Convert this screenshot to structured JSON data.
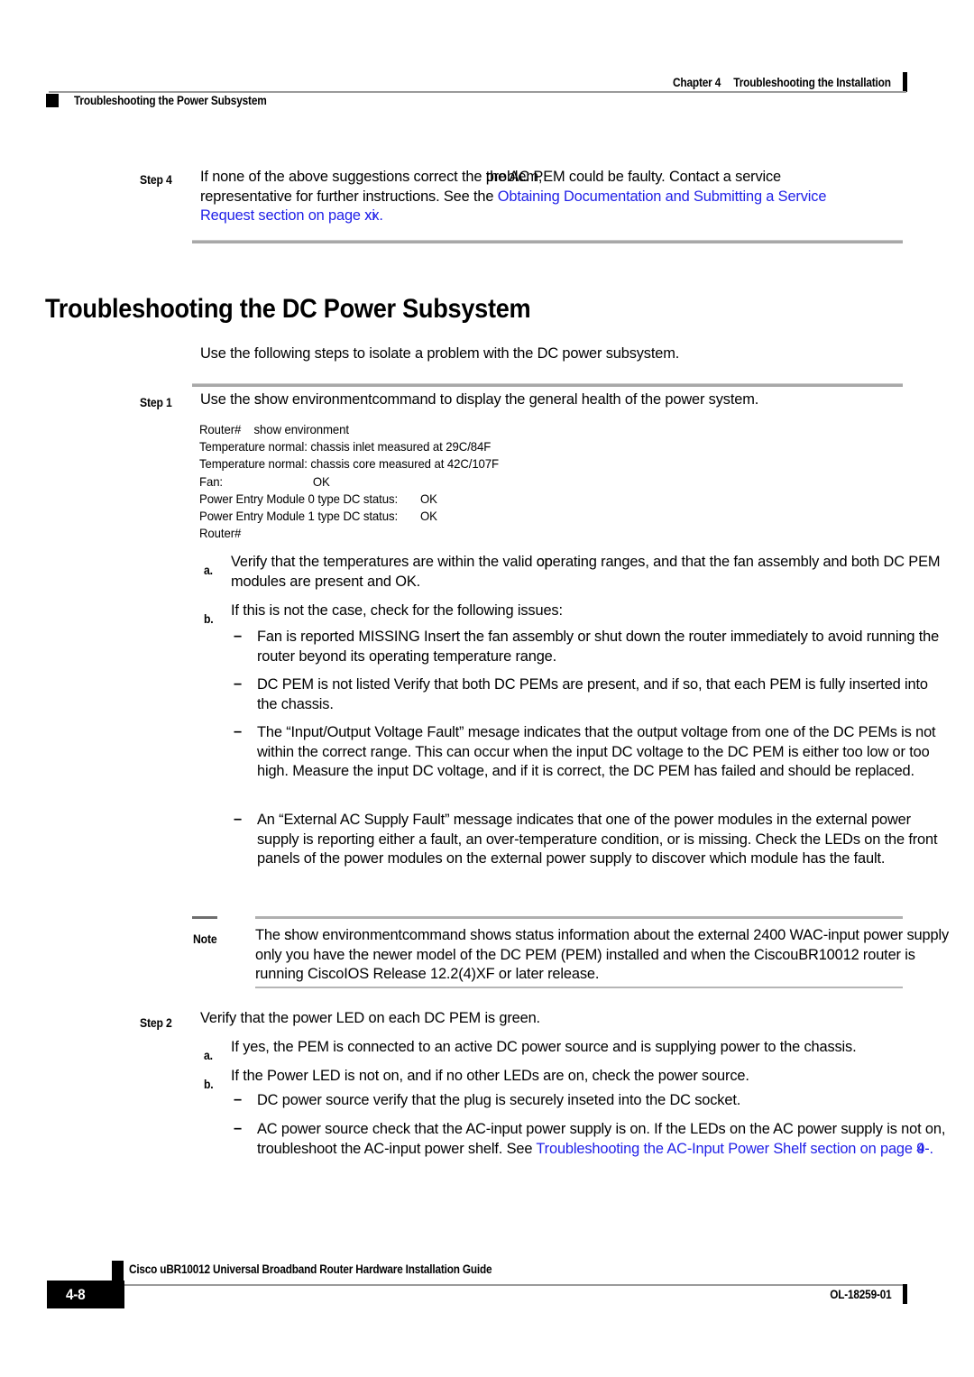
{
  "header": {
    "chapter_num": "Chapter 4",
    "chapter_title": "Troubleshooting the Installation",
    "section_title": "Troubleshooting the Power Subsystem"
  },
  "step4": {
    "label": "Step 4",
    "line1_a": "If none of the above suggestions correct the problem,",
    "line1_b": "the AC PEM could be faulty. Contact a service",
    "line1_prefix": "If none of the above suggestions correct the ",
    "line2_plain": "representative for further instructions. See the ",
    "line2_link": "Obtaining Documentation and Submitting a Service",
    "line3_link": "Request",
    "line3_mid": " section on page ",
    "line3_page_a": "xx",
    "line3_page_b": "xi",
    "line3_end": "."
  },
  "heading": "Troubleshooting the DC Power Subsystem",
  "intro": "Use the following steps to isolate a problem with the DC power subsystem.",
  "step1": {
    "label": "Step 1",
    "text_prefix": "Use the ",
    "command_a": "show environment",
    "command_b": "command",
    "text_suffix": " to display the general health of the power system."
  },
  "cli_output": "Router#    show environment\nTemperature normal: chassis inlet measured at 29C/84F\nTemperature normal: chassis core measured at 42C/107F\nFan:                            OK\nPower Entry Module 0 type DC status:       OK\nPower Entry Module 1 type DC status:       OK\nRouter#",
  "step1_items": [
    {
      "label": "a.",
      "pre": "Verify that the temperatures are within the valid ",
      "ovl_a": "oper",
      "ovl_b": "op",
      "post": "ating ranges, and that the fan assembly and both DC PEM modules are present and OK."
    },
    {
      "label": "b.",
      "text": "If this is not the case, check for the following issues:"
    }
  ],
  "step1_dashes": [
    {
      "dash": "–",
      "pre": "Fan is reported MISSING",
      "ovl_a": "—",
      "post": " Insert the fan assembly or shut down the router immediately to avoid running the router beyond its operating temperature range."
    },
    {
      "dash": "–",
      "pre": "DC PEM is not listed",
      "ovl_a": "s",
      "ovl_b": "a",
      "post": "Verify that both DC PEMs are present, and if so, that each PEM is fully inserted into the chassis."
    },
    {
      "dash": "–",
      "pre": "The “Input/Output Voltage Fault” me",
      "ovl_a": "ss",
      "ovl_b": "s",
      "post": "sage indicates that the output voltage from one of the DC PEMs is not within the correct range. This can occur when the input DC voltage to the DC PEM is either too low or too high. Measure the input DC voltage, and if it is correct, the DC PEM has failed and should be replaced."
    },
    {
      "dash": "–",
      "pre": "An “External AC Supply Fault” message indicates",
      "ovl_a": "th",
      "ovl_b": "a",
      "post": "that one of the power modules in the external power supply is reporting either a fault, an over-temperature condition, or is missing. Check the LEDs on the front panels of the power modules on the external power supply to discover which module has the fault."
    }
  ],
  "note": {
    "label": "Note",
    "line1_pre": "The ",
    "line1_cmd_a": "show environment",
    "line1_cmd_b": "command",
    "line1_post": " shows status information about the external 2400 WAC-input",
    "line2": "power supply only you have the newer model of the DC PEM (PEM) installed and when the",
    "line3_a": "Cisco",
    "line3_b": "uBR10012",
    "line3_c": " router is running Cisco",
    "line3_d": "IOS",
    "line3_e": " Release 12.2(4)XF or later release."
  },
  "step2": {
    "label": "Step 2",
    "text": "Verify that the power LED on each DC PEM is green."
  },
  "step2_items": [
    {
      "label": "a.",
      "text": "If yes, the PEM is connected to an active DC power source and is supplying power to the chassis."
    },
    {
      "label": "b.",
      "text": "If the Power LED is not on, and if no other LEDs are on, check the power source."
    }
  ],
  "step2_dashes": [
    {
      "dash": "–",
      "pre": "DC power source",
      "ovl_a": "—",
      "mid": " verify that the plug is securely inse",
      "ovl2_a": "rt",
      "ovl2_b": "e",
      "post": "ted into the DC socket."
    },
    {
      "dash": "–",
      "pre": "AC power source",
      "ovl_a": "—",
      "mid": " check that the AC-input power supply is on. If the LEDs on the AC power supply is not on, troubleshoot the AC-input power shelf. See ",
      "link1": "Troubleshooting the AC-Input",
      "link2": "Power Shelf",
      "link_mid": " section on page ",
      "page_a": "4-",
      "page_b": "9",
      "link_end": "."
    }
  ],
  "footer": {
    "title": "Cisco uBR10012 Universal Broadband Router Hardware Installation Guide",
    "page": "4-8",
    "doc_id": "OL-18259-01"
  },
  "colors": {
    "link": "#1f1fe8",
    "rule": "#a8a8a8",
    "text": "#000000"
  }
}
